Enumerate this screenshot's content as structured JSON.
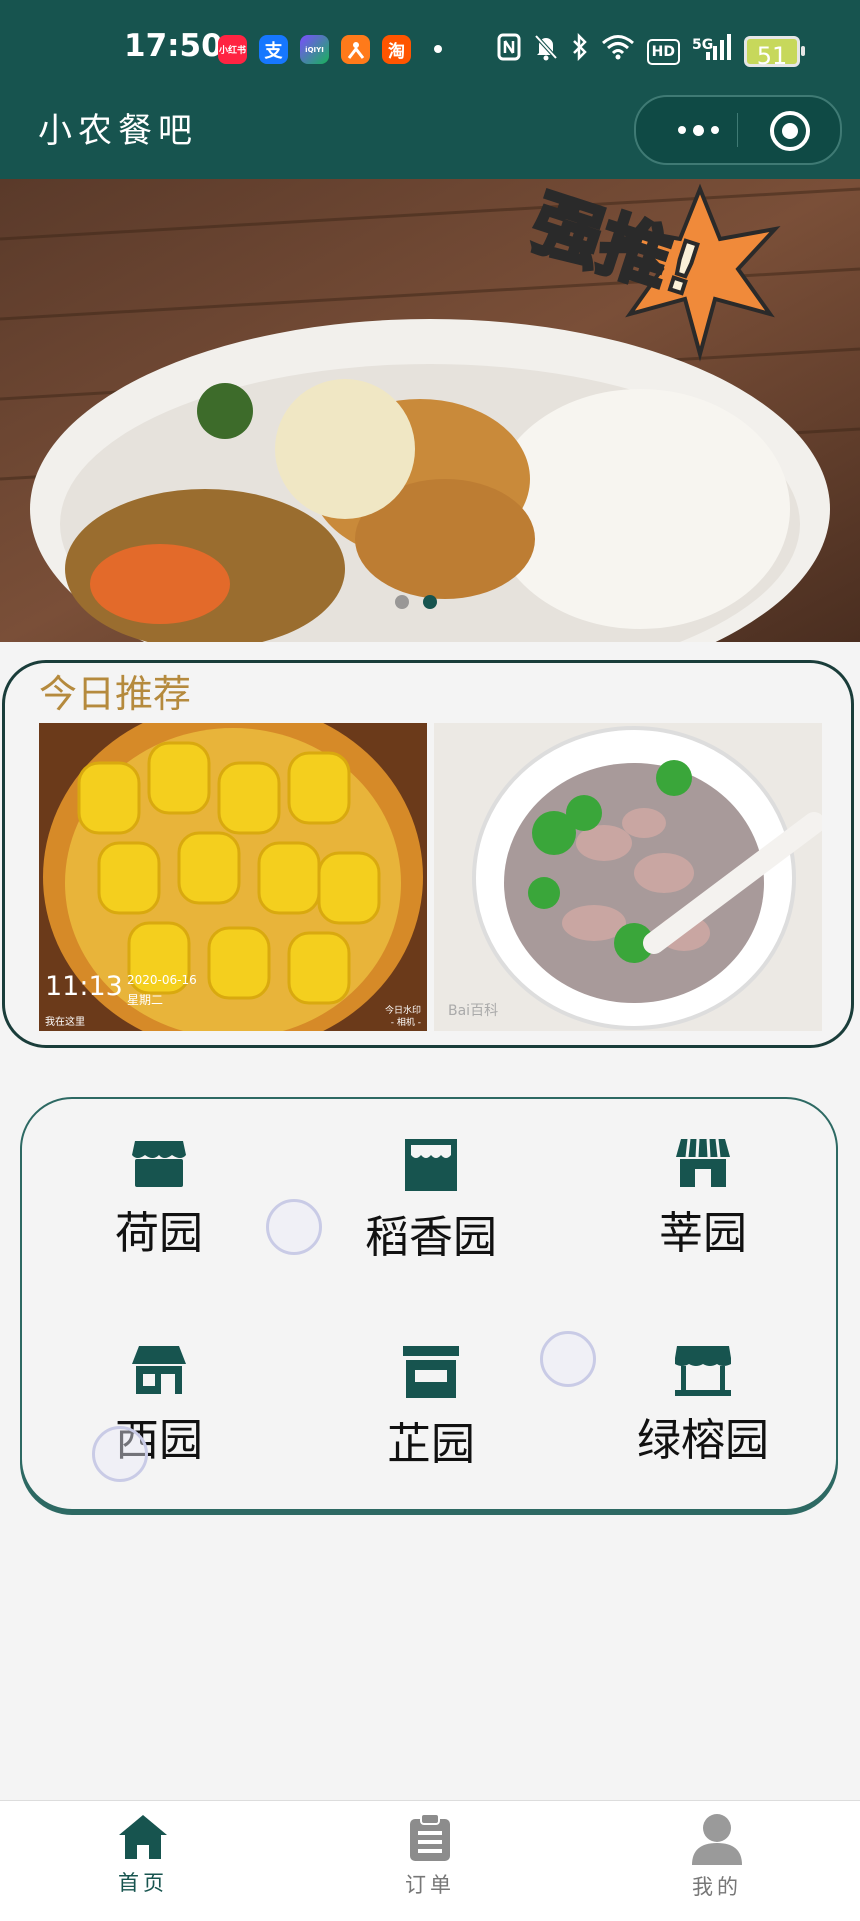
{
  "status_bar": {
    "time": "17:50",
    "apps": [
      {
        "name": "xiaohongshu-icon",
        "label": "小红书",
        "color": "#ff2442"
      },
      {
        "name": "alipay-icon",
        "label": "支",
        "color": "#1677ff"
      },
      {
        "name": "iqiyi-icon",
        "label": "iQIYI",
        "color": "#18b35a"
      },
      {
        "name": "app-orange-icon",
        "label": "",
        "color": "#ff7a1a"
      },
      {
        "name": "taobao-icon",
        "label": "淘",
        "color": "#ff5500"
      }
    ],
    "hd_label": "HD",
    "network_label": "5G",
    "battery_level": "51"
  },
  "nav": {
    "title": "小农餐吧"
  },
  "banner": {
    "badge_text": "强推!",
    "slide_count": 2,
    "active_slide": 2
  },
  "recommend": {
    "title": "今日推荐",
    "items": [
      {
        "name": "corn",
        "overlay_time": "11:13",
        "overlay_date": "2020-06-16",
        "overlay_weekday": "星期二",
        "overlay_location": "我在这里",
        "overlay_watermark_1": "今日水印",
        "overlay_watermark_2": "- 相机 -"
      },
      {
        "name": "pork-soup",
        "watermark": "Bai百科"
      }
    ]
  },
  "shops": [
    {
      "name": "荷园",
      "icon": "store-awning-icon"
    },
    {
      "name": "稻香园",
      "icon": "store-front-icon"
    },
    {
      "name": "莘园",
      "icon": "store-striped-icon"
    },
    {
      "name": "西园",
      "icon": "store-house-icon"
    },
    {
      "name": "芷园",
      "icon": "store-box-icon"
    },
    {
      "name": "绿榕园",
      "icon": "store-kiosk-icon"
    }
  ],
  "tabbar": {
    "items": [
      {
        "label": "首页",
        "icon": "home-icon",
        "active": true
      },
      {
        "label": "订单",
        "icon": "clipboard-icon",
        "active": false
      },
      {
        "label": "我的",
        "icon": "user-icon",
        "active": false
      }
    ]
  },
  "colors": {
    "primary": "#17544f",
    "accent_title": "#b58a3d",
    "background": "#f4f4f4"
  }
}
